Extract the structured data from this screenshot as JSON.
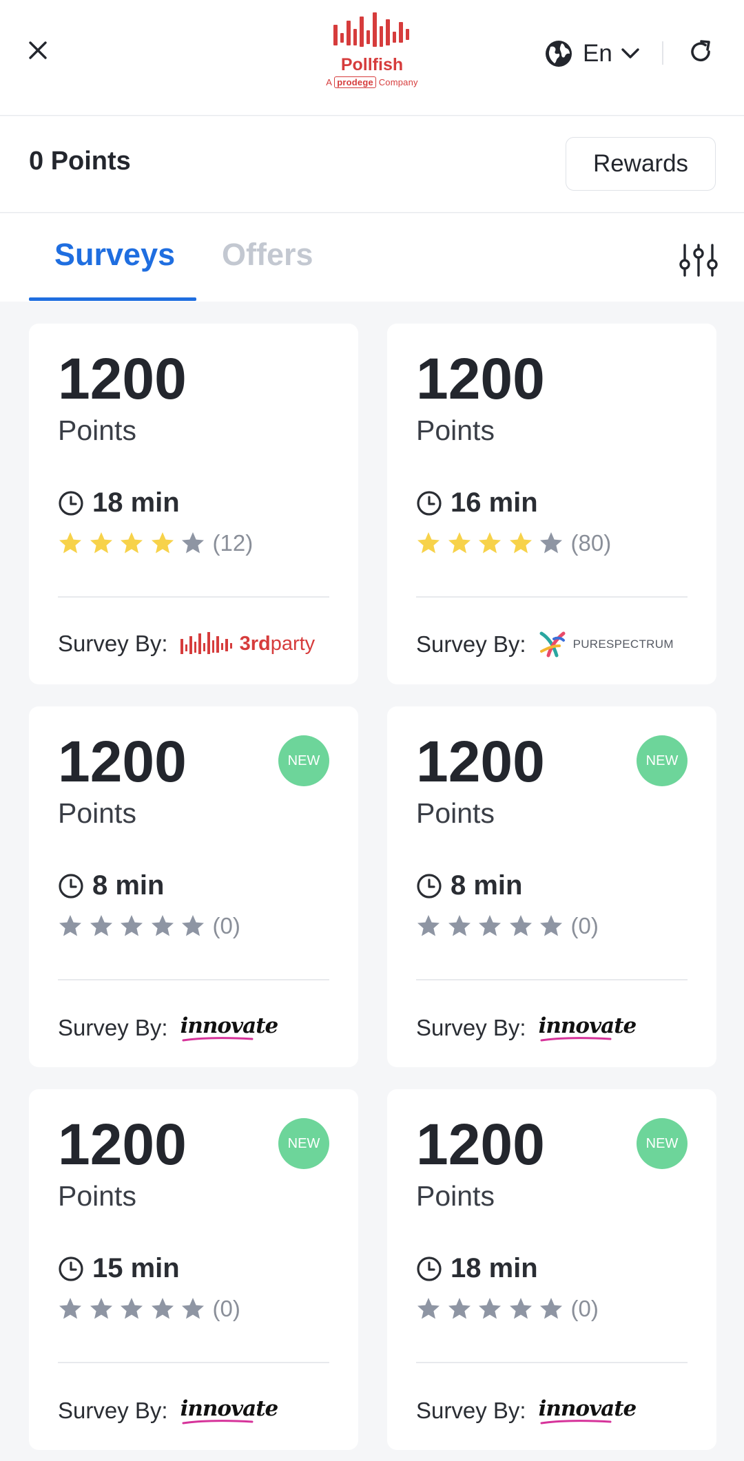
{
  "header": {
    "close_icon": "close-icon",
    "logo": {
      "name": "Pollfish",
      "sub_prefix": "A",
      "sub_brand": "prodege",
      "sub_suffix": "Company",
      "color": "#d63c3c"
    },
    "language": {
      "value": "En",
      "icon": "globe-icon",
      "chevron": "chevron-down-icon"
    },
    "refresh_icon": "refresh-icon"
  },
  "points_bar": {
    "label": "0 Points",
    "rewards_label": "Rewards"
  },
  "tabs": [
    {
      "label": "Surveys",
      "active": true
    },
    {
      "label": "Offers",
      "active": false
    }
  ],
  "filter_icon": "sliders-icon",
  "colors": {
    "accent": "#1f6ee0",
    "star_filled": "#f7d24a",
    "star_empty": "#8e95a3",
    "badge_new": "#6dd59a",
    "brand_red": "#d63c3c"
  },
  "survey_by_label": "Survey By:",
  "surveys": [
    {
      "points": "1200",
      "points_label": "Points",
      "is_new": false,
      "badge": "",
      "duration": "18 min",
      "rating": 4,
      "reviews": "(12)",
      "provider": "3rdparty",
      "provider_a": "3rd",
      "provider_b": "party"
    },
    {
      "points": "1200",
      "points_label": "Points",
      "is_new": false,
      "badge": "",
      "duration": "16 min",
      "rating": 4,
      "reviews": "(80)",
      "provider": "PURESPECTRUM"
    },
    {
      "points": "1200",
      "points_label": "Points",
      "is_new": true,
      "badge": "NEW",
      "duration": "8 min",
      "rating": 0,
      "reviews": "(0)",
      "provider": "innovate"
    },
    {
      "points": "1200",
      "points_label": "Points",
      "is_new": true,
      "badge": "NEW",
      "duration": "8 min",
      "rating": 0,
      "reviews": "(0)",
      "provider": "innovate"
    },
    {
      "points": "1200",
      "points_label": "Points",
      "is_new": true,
      "badge": "NEW",
      "duration": "15 min",
      "rating": 0,
      "reviews": "(0)",
      "provider": "innovate"
    },
    {
      "points": "1200",
      "points_label": "Points",
      "is_new": true,
      "badge": "NEW",
      "duration": "18 min",
      "rating": 0,
      "reviews": "(0)",
      "provider": "innovate"
    }
  ]
}
